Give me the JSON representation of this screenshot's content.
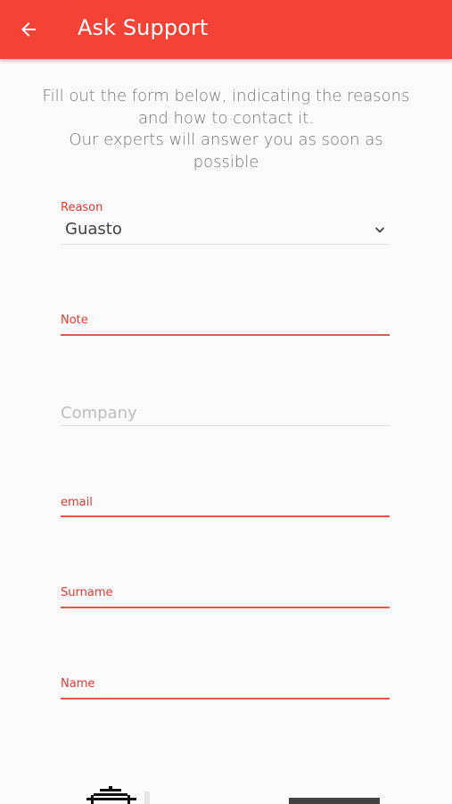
{
  "appbar": {
    "title": "Ask Support",
    "color": "#f44336"
  },
  "intro": {
    "lines": [
      "Fill out the form below, indicating the reasons",
      "and how to contact it.",
      "Our experts will answer you as soon as",
      "possible"
    ]
  },
  "form": {
    "reason": {
      "label": "Reason",
      "value": "Guasto"
    },
    "note": {
      "label": "Note"
    },
    "company": {
      "placeholder": "Company"
    },
    "email": {
      "label": "email"
    },
    "surname": {
      "label": "Surname"
    },
    "name": {
      "label": "Name"
    }
  },
  "icons": {
    "back": "arrow-back-icon",
    "dropdown": "chevron-down-icon"
  }
}
